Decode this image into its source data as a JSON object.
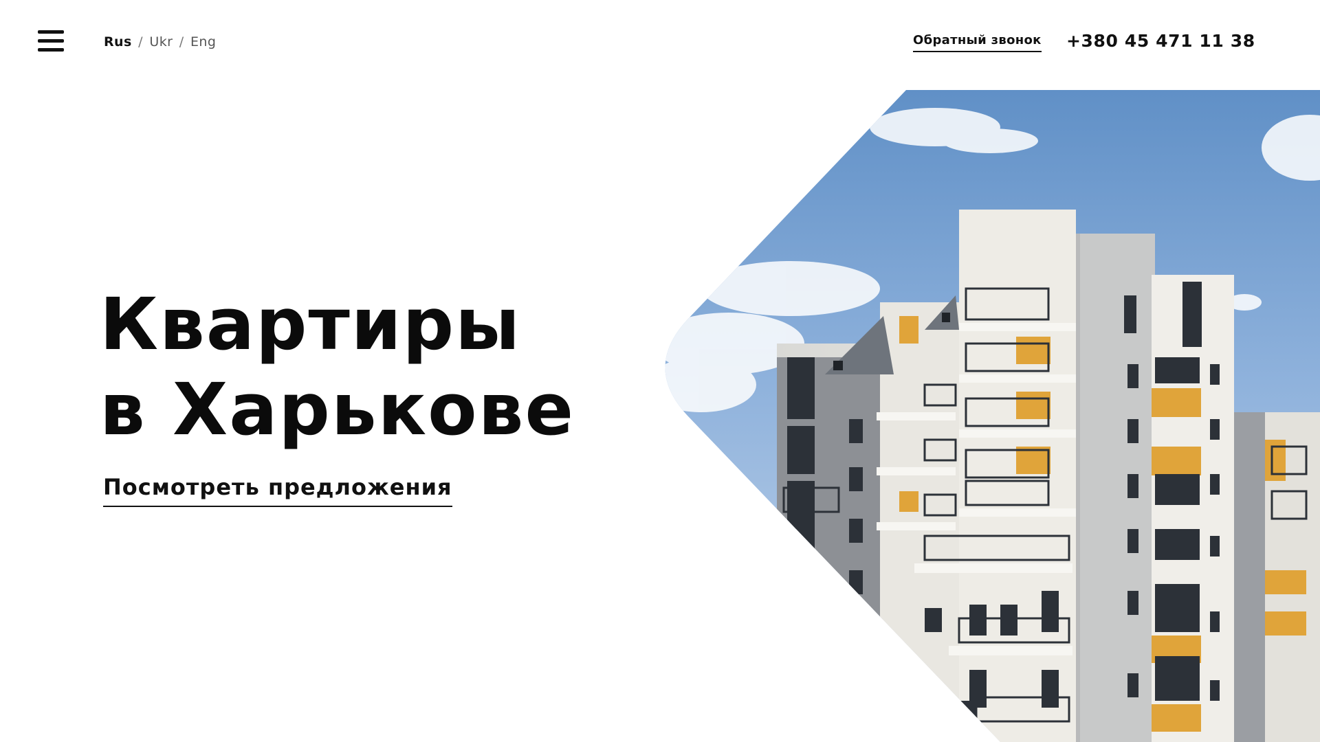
{
  "header": {
    "menu_icon": "hamburger-menu-icon",
    "languages": [
      {
        "label": "Rus",
        "active": true
      },
      {
        "label": "Ukr",
        "active": false
      },
      {
        "label": "Eng",
        "active": false
      }
    ],
    "language_separator": "/",
    "callback_label": "Обратный звонок",
    "phone": "+380 45 471 11 38"
  },
  "hero": {
    "title_line1": "Квартиры",
    "title_line2": "в Харькове",
    "cta_label": "Посмотреть предложения"
  },
  "colors": {
    "text": "#0d0d0d",
    "background": "#ffffff",
    "sky": "#7fa6d6",
    "facade": "#e8e6e0",
    "accent_orange": "#e0a43a",
    "gray_panel": "#8b8e93"
  }
}
